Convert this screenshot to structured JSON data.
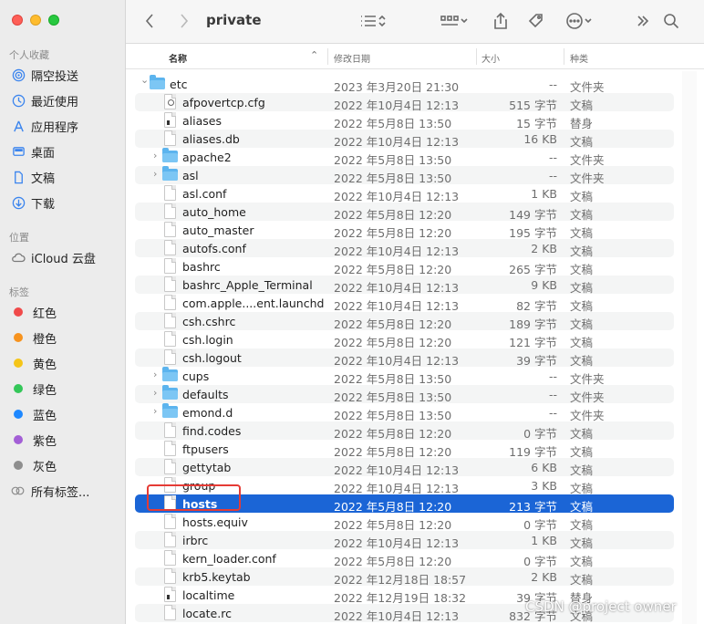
{
  "window": {
    "title": "private"
  },
  "sidebar": {
    "favorites_title": "个人收藏",
    "favorites": [
      {
        "label": "隔空投送",
        "icon": "airdrop-icon"
      },
      {
        "label": "最近使用",
        "icon": "recents-clock-icon"
      },
      {
        "label": "应用程序",
        "icon": "applications-icon"
      },
      {
        "label": "桌面",
        "icon": "desktop-icon"
      },
      {
        "label": "文稿",
        "icon": "document-icon"
      },
      {
        "label": "下载",
        "icon": "downloads-icon"
      }
    ],
    "locations_title": "位置",
    "locations": [
      {
        "label": "iCloud 云盘",
        "icon": "cloud-icon"
      }
    ],
    "tags_title": "标签",
    "tags": [
      {
        "label": "红色",
        "color": "#f04a4a"
      },
      {
        "label": "橙色",
        "color": "#f7931e"
      },
      {
        "label": "黄色",
        "color": "#f5c518"
      },
      {
        "label": "绿色",
        "color": "#34c759"
      },
      {
        "label": "蓝色",
        "color": "#1e88ff"
      },
      {
        "label": "紫色",
        "color": "#a35fd6"
      },
      {
        "label": "灰色",
        "color": "#8e8e8e"
      }
    ],
    "all_tags_label": "所有标签..."
  },
  "columns": {
    "name": "名称",
    "date": "修改日期",
    "size": "大小",
    "kind": "种类"
  },
  "rows": [
    {
      "name": "etc",
      "date": "2023 年3月20日 21:30",
      "size": "--",
      "kind": "文件夹",
      "type": "folder",
      "expand": "open"
    },
    {
      "name": "afpovertcp.cfg",
      "date": "2022 年10月4日 12:13",
      "size": "515 字节",
      "kind": "文稿",
      "type": "cfg"
    },
    {
      "name": "aliases",
      "date": "2022 年5月8日 13:50",
      "size": "15 字节",
      "kind": "替身",
      "type": "exec"
    },
    {
      "name": "aliases.db",
      "date": "2022 年10月4日 12:13",
      "size": "16 KB",
      "kind": "文稿",
      "type": "doc"
    },
    {
      "name": "apache2",
      "date": "2022 年5月8日 13:50",
      "size": "--",
      "kind": "文件夹",
      "type": "folder",
      "expand": "closed"
    },
    {
      "name": "asl",
      "date": "2022 年5月8日 13:50",
      "size": "--",
      "kind": "文件夹",
      "type": "folder",
      "expand": "closed"
    },
    {
      "name": "asl.conf",
      "date": "2022 年10月4日 12:13",
      "size": "1 KB",
      "kind": "文稿",
      "type": "doc"
    },
    {
      "name": "auto_home",
      "date": "2022 年5月8日 12:20",
      "size": "149 字节",
      "kind": "文稿",
      "type": "doc"
    },
    {
      "name": "auto_master",
      "date": "2022 年5月8日 12:20",
      "size": "195 字节",
      "kind": "文稿",
      "type": "doc"
    },
    {
      "name": "autofs.conf",
      "date": "2022 年10月4日 12:13",
      "size": "2 KB",
      "kind": "文稿",
      "type": "doc"
    },
    {
      "name": "bashrc",
      "date": "2022 年5月8日 12:20",
      "size": "265 字节",
      "kind": "文稿",
      "type": "doc"
    },
    {
      "name": "bashrc_Apple_Terminal",
      "date": "2022 年10月4日 12:13",
      "size": "9 KB",
      "kind": "文稿",
      "type": "doc"
    },
    {
      "name": "com.apple....ent.launchd",
      "date": "2022 年10月4日 12:13",
      "size": "82 字节",
      "kind": "文稿",
      "type": "doc"
    },
    {
      "name": "csh.cshrc",
      "date": "2022 年5月8日 12:20",
      "size": "189 字节",
      "kind": "文稿",
      "type": "doc"
    },
    {
      "name": "csh.login",
      "date": "2022 年5月8日 12:20",
      "size": "121 字节",
      "kind": "文稿",
      "type": "doc"
    },
    {
      "name": "csh.logout",
      "date": "2022 年10月4日 12:13",
      "size": "39 字节",
      "kind": "文稿",
      "type": "doc"
    },
    {
      "name": "cups",
      "date": "2022 年5月8日 13:50",
      "size": "--",
      "kind": "文件夹",
      "type": "folder",
      "expand": "closed"
    },
    {
      "name": "defaults",
      "date": "2022 年5月8日 13:50",
      "size": "--",
      "kind": "文件夹",
      "type": "folder",
      "expand": "closed"
    },
    {
      "name": "emond.d",
      "date": "2022 年5月8日 13:50",
      "size": "--",
      "kind": "文件夹",
      "type": "folder",
      "expand": "closed"
    },
    {
      "name": "find.codes",
      "date": "2022 年5月8日 12:20",
      "size": "0 字节",
      "kind": "文稿",
      "type": "doc"
    },
    {
      "name": "ftpusers",
      "date": "2022 年5月8日 12:20",
      "size": "119 字节",
      "kind": "文稿",
      "type": "doc"
    },
    {
      "name": "gettytab",
      "date": "2022 年10月4日 12:13",
      "size": "6 KB",
      "kind": "文稿",
      "type": "doc"
    },
    {
      "name": "group",
      "date": "2022 年10月4日 12:13",
      "size": "3 KB",
      "kind": "文稿",
      "type": "doc"
    },
    {
      "name": "hosts",
      "date": "2022 年5月8日 12:20",
      "size": "213 字节",
      "kind": "文稿",
      "type": "doc",
      "selected": true
    },
    {
      "name": "hosts.equiv",
      "date": "2022 年5月8日 12:20",
      "size": "0 字节",
      "kind": "文稿",
      "type": "doc"
    },
    {
      "name": "irbrc",
      "date": "2022 年10月4日 12:13",
      "size": "1 KB",
      "kind": "文稿",
      "type": "doc"
    },
    {
      "name": "kern_loader.conf",
      "date": "2022 年5月8日 12:20",
      "size": "0 字节",
      "kind": "文稿",
      "type": "doc"
    },
    {
      "name": "krb5.keytab",
      "date": "2022 年12月18日 18:57",
      "size": "2 KB",
      "kind": "文稿",
      "type": "doc"
    },
    {
      "name": "localtime",
      "date": "2022 年12月19日 18:32",
      "size": "39 字节",
      "kind": "替身",
      "type": "exec"
    },
    {
      "name": "locate.rc",
      "date": "2022 年10月4日 12:13",
      "size": "832 字节",
      "kind": "文稿",
      "type": "doc"
    }
  ],
  "watermark": "CSDN @project owner"
}
